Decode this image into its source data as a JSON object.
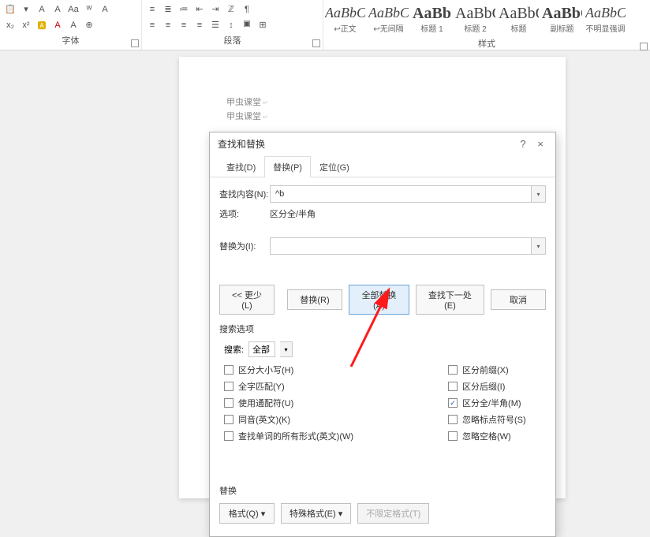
{
  "ribbon": {
    "font_label": "字体",
    "para_label": "段落",
    "style_label": "样式",
    "x2": "x₂",
    "x1": "x²",
    "styles": [
      {
        "preview": "AaBbCcDd",
        "name": "↩正文",
        "cls": "big1"
      },
      {
        "preview": "AaBbCcDd",
        "name": "↩无间隔",
        "cls": "big1"
      },
      {
        "preview": "AaBb",
        "name": "标题 1",
        "cls": "big2",
        "bold": true
      },
      {
        "preview": "AaBbC",
        "name": "标题 2",
        "cls": "big2"
      },
      {
        "preview": "AaBbC",
        "name": "标题",
        "cls": "big2"
      },
      {
        "preview": "AaBbC",
        "name": "副标题",
        "cls": "big2",
        "bold": true
      },
      {
        "preview": "AaBbCcDd",
        "name": "不明显强调",
        "cls": "big1"
      }
    ]
  },
  "doc": {
    "line1": "甲虫课堂",
    "line2": "甲虫课堂"
  },
  "dialog": {
    "title": "查找和替换",
    "help": "?",
    "close": "×",
    "tabs": {
      "find": "查找(D)",
      "replace": "替换(P)",
      "goto": "定位(G)"
    },
    "find_label": "查找内容(N):",
    "find_value": "^b",
    "options_label": "选项:",
    "options_value": "区分全/半角",
    "replace_label": "替换为(I):",
    "replace_value": "",
    "less": "<< 更少(L)",
    "btn_replace": "替换(R)",
    "btn_replace_all": "全部替换(A)",
    "btn_find_next": "查找下一处(E)",
    "btn_cancel": "取消",
    "search_opts_label": "搜索选项",
    "search_label": "搜索:",
    "search_scope": "全部",
    "chk_left": [
      {
        "label": "区分大小写(H)",
        "checked": false
      },
      {
        "label": "全字匹配(Y)",
        "checked": false
      },
      {
        "label": "使用通配符(U)",
        "checked": false
      },
      {
        "label": "同音(英文)(K)",
        "checked": false
      },
      {
        "label": "查找单词的所有形式(英文)(W)",
        "checked": false
      }
    ],
    "chk_right": [
      {
        "label": "区分前缀(X)",
        "checked": false
      },
      {
        "label": "区分后缀(I)",
        "checked": false
      },
      {
        "label": "区分全/半角(M)",
        "checked": true
      },
      {
        "label": "忽略标点符号(S)",
        "checked": false
      },
      {
        "label": "忽略空格(W)",
        "checked": false
      }
    ],
    "replace_section": "替换",
    "btn_format": "格式(Q) ▾",
    "btn_special": "特殊格式(E) ▾",
    "btn_noformat": "不限定格式(T)"
  }
}
